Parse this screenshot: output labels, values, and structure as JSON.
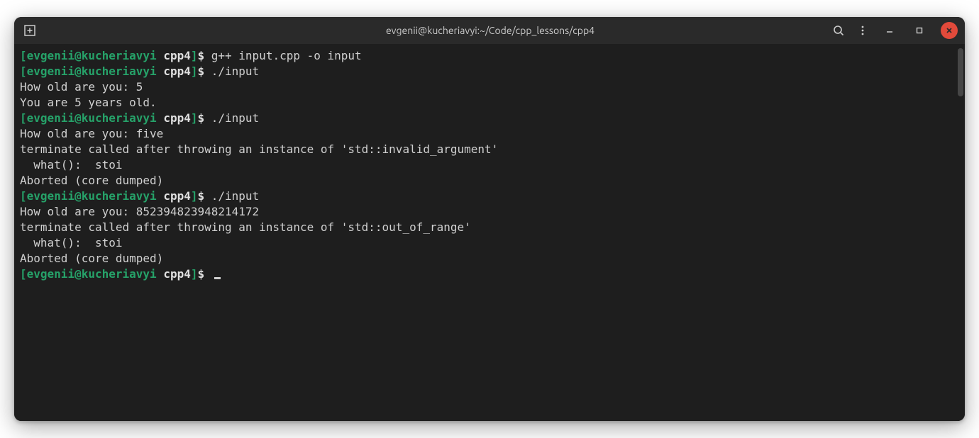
{
  "titlebar": {
    "title": "evgenii@kucheriavyi:~/Code/cpp_lessons/cpp4"
  },
  "prompt": {
    "open": "[",
    "user_host": "evgenii@kucheriavyi",
    "space": " ",
    "cwd": "cpp4",
    "close": "]",
    "symbol": "$ "
  },
  "session": {
    "cmd1": "g++ input.cpp -o input",
    "cmd2": "./input",
    "out1a": "How old are you: 5",
    "out1b": "You are 5 years old.",
    "cmd3": "./input",
    "out2a": "How old are you: five",
    "out2b": "terminate called after throwing an instance of 'std::invalid_argument'",
    "out2c": "  what():  stoi",
    "out2d": "Aborted (core dumped)",
    "cmd4": "./input",
    "out3a": "How old are you: 852394823948214172",
    "out3b": "terminate called after throwing an instance of 'std::out_of_range'",
    "out3c": "  what():  stoi",
    "out3d": "Aborted (core dumped)"
  }
}
